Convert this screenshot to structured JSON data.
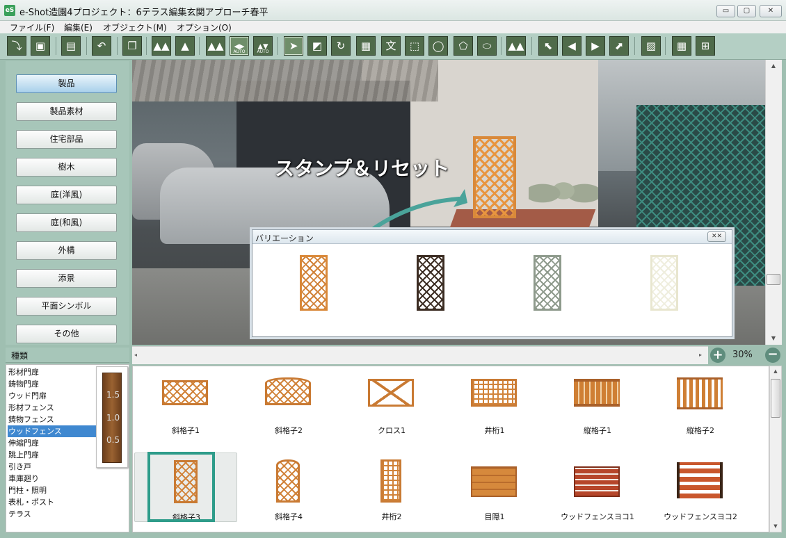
{
  "window": {
    "app_icon": "eS",
    "title": "e-Shot造園4プロジェクト：6テラス編集玄関アプローチ春平",
    "minimize_label": "▭",
    "maximize_label": "▢",
    "close_label": "✕"
  },
  "menu": [
    {
      "label": "ファイル(F)"
    },
    {
      "label": "編集(E)"
    },
    {
      "label": "オブジェクト(M)"
    },
    {
      "label": "オプション(O)"
    }
  ],
  "toolbar": {
    "auto_label_1": "AUTO",
    "auto_label_2": "AUTO",
    "text_tool_glyph": "文"
  },
  "categories": [
    {
      "label": "製品",
      "selected": true
    },
    {
      "label": "製品素材"
    },
    {
      "label": "住宅部品"
    },
    {
      "label": "樹木"
    },
    {
      "label": "庭(洋風)"
    },
    {
      "label": "庭(和風)"
    },
    {
      "label": "外構"
    },
    {
      "label": "添景"
    },
    {
      "label": "平面シンボル"
    },
    {
      "label": "その他"
    }
  ],
  "canvas": {
    "overlay_text": "スタンプ＆リセット"
  },
  "variation_window": {
    "title": "バリエーション",
    "close_label": "✕✕",
    "variants": [
      {
        "color": "#d9893a"
      },
      {
        "color": "#3b2c22"
      },
      {
        "color": "#8e9a8c"
      },
      {
        "color": "#efeede"
      }
    ]
  },
  "zoom": {
    "value": "30%",
    "plus": "+",
    "minus": "−"
  },
  "type_panel": {
    "header": "種類",
    "items": [
      {
        "label": "形材門扉"
      },
      {
        "label": "鋳物門扉"
      },
      {
        "label": "ウッド門扉"
      },
      {
        "label": "形材フェンス"
      },
      {
        "label": "鋳物フェンス"
      },
      {
        "label": "ウッドフェンス",
        "selected": true
      },
      {
        "label": "伸縮門扉"
      },
      {
        "label": "跳上門扉"
      },
      {
        "label": "引き戸"
      },
      {
        "label": "車庫廻り"
      },
      {
        "label": "門柱・照明"
      },
      {
        "label": "表札・ポスト"
      },
      {
        "label": "テラス"
      }
    ],
    "gauge_labels": [
      "1.5",
      "1.0",
      "0.5"
    ]
  },
  "products": [
    {
      "name": "斜格子1"
    },
    {
      "name": "斜格子2"
    },
    {
      "name": "クロス1"
    },
    {
      "name": "井桁1"
    },
    {
      "name": "縦格子1"
    },
    {
      "name": "縦格子2"
    },
    {
      "name": "斜格子3",
      "selected": true
    },
    {
      "name": "斜格子4"
    },
    {
      "name": "井桁2"
    },
    {
      "name": "目隠1"
    },
    {
      "name": "ウッドフェンスヨコ1"
    },
    {
      "name": "ウッドフェンスヨコ2"
    }
  ],
  "colors": {
    "accent_highlight": "#2e9c8a",
    "panel_bg": "#a7c6b9",
    "toolbar_icon": "#4f6b4a",
    "selection_blue": "#3f88d0"
  }
}
